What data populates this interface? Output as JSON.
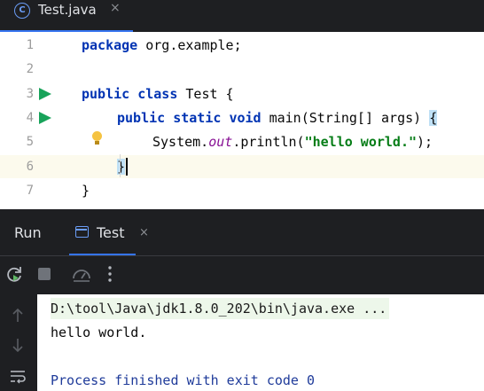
{
  "editor_tab": {
    "filename": "Test.java",
    "icon": "java-class-icon",
    "close": "×"
  },
  "editor": {
    "lines": [
      {
        "num": "1",
        "text": "package org.example;"
      },
      {
        "num": "2",
        "text": ""
      },
      {
        "num": "3",
        "text": "public class Test {"
      },
      {
        "num": "4",
        "text": "public static void main(String[] args) {"
      },
      {
        "num": "5",
        "text": "System.out.println(\"hello world.\");"
      },
      {
        "num": "6",
        "text": "}"
      },
      {
        "num": "7",
        "text": "}"
      }
    ],
    "tokens": {
      "package": "package",
      "pkg_name": " org.example;",
      "public": "public",
      "class": "class",
      "class_rest": " Test {",
      "static": "static",
      "void": "void",
      "main_rest": " main(String[] args) ",
      "brace_open": "{",
      "system": "System.",
      "out": "out",
      "println": ".println(",
      "string": "\"hello world.\"",
      "call_end": ");",
      "brace_close": "}"
    }
  },
  "run_window": {
    "title": "Run",
    "tab_label": "Test",
    "tab_close": "×",
    "toolbar": [
      "rerun-icon",
      "stop-icon",
      "profiler-icon",
      "more-options-icon"
    ],
    "side": [
      "scroll-up-icon",
      "scroll-down-icon",
      "soft-wrap-icon"
    ]
  },
  "console": {
    "command": "D:\\tool\\Java\\jdk1.8.0_202\\bin\\java.exe ...",
    "output": "hello world.",
    "exit": "Process finished with exit code 0"
  },
  "colors": {
    "keyword": "#0033b3",
    "string": "#067d17",
    "field": "#871094",
    "run_green": "#18a35a",
    "accent": "#3574f0"
  }
}
